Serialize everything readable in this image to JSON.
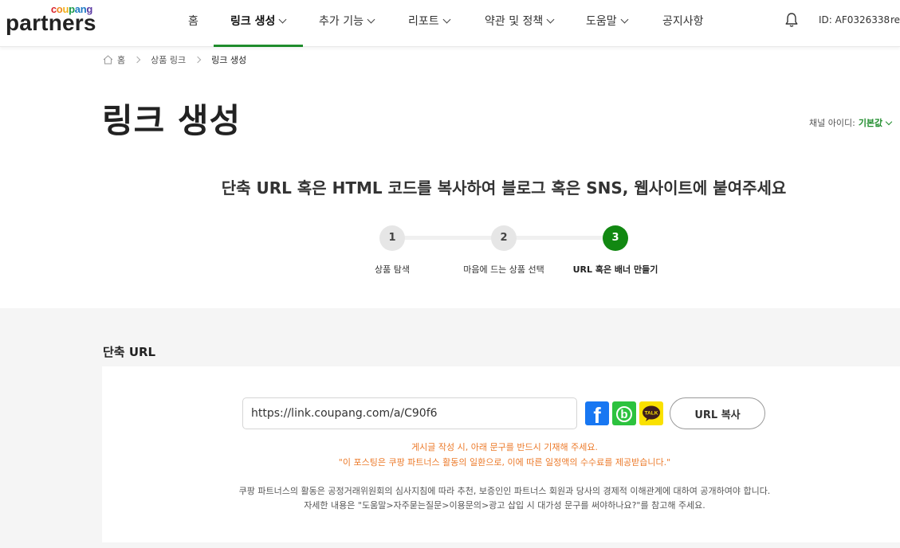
{
  "header": {
    "logo_top": [
      "c",
      "o",
      "u",
      "p",
      "a",
      "n",
      "g"
    ],
    "logo_top_colors": [
      "#d9242c",
      "#f0891f",
      "#f2b21b",
      "#1c9a4a",
      "#1e7ac4",
      "#1e7ac4",
      "#5b3aa3"
    ],
    "logo_main": "partners",
    "nav": [
      {
        "label": "홈",
        "dropdown": false
      },
      {
        "label": "링크 생성",
        "dropdown": true,
        "active": true
      },
      {
        "label": "추가 기능",
        "dropdown": true
      },
      {
        "label": "리포트",
        "dropdown": true
      },
      {
        "label": "약관 및 정책",
        "dropdown": true
      },
      {
        "label": "도움말",
        "dropdown": true
      },
      {
        "label": "공지사항",
        "dropdown": false
      }
    ],
    "user_id": "ID: AF0326338",
    "user_more": "re",
    "accent": "#1f8c2c"
  },
  "breadcrumb": [
    "홈",
    "상품 링크",
    "링크 생성"
  ],
  "page_title": "링크 생성",
  "channel": {
    "label": "채널 아이디:",
    "value": "기본값"
  },
  "instruction": "단축 URL 혹은 HTML 코드를 복사하여 블로그 혹은 SNS, 웹사이트에 붙여주세요",
  "steps": [
    {
      "number": "1",
      "label": "상품 탐색",
      "active": false
    },
    {
      "number": "2",
      "label": "마음에 드는 상품 선택",
      "active": false
    },
    {
      "number": "3",
      "label": "URL 혹은 배너 만들기",
      "active": true
    }
  ],
  "short_url": {
    "section_title": "단축 URL",
    "value": "https://link.coupang.com/a/C90f6",
    "share": [
      {
        "name": "facebook-icon",
        "glyph": "f"
      },
      {
        "name": "band-icon",
        "glyph": "b"
      },
      {
        "name": "kakaotalk-icon",
        "glyph": "TALK"
      }
    ],
    "copy_label": "URL 복사"
  },
  "notice": [
    "게시글 작성 시, 아래 문구를 반드시 기재해 주세요.",
    "\"이 포스팅은 쿠팡 파트너스 활동의 일환으로, 이에 따른 일정액의 수수료를 제공받습니다.\""
  ],
  "disclaimer": [
    "쿠팡 파트너스의 활동은 공정거래위원회의 심사지침에 따라 추천, 보증인인 파트너스 회원과 당사의 경제적 이해관계에 대하여 공개하여야 합니다.",
    "자세한 내용은 \"도움말>자주묻는질문>이용문의>광고 삽입 시 대가성 문구를 써야하나요?\"를 참고해 주세요."
  ]
}
